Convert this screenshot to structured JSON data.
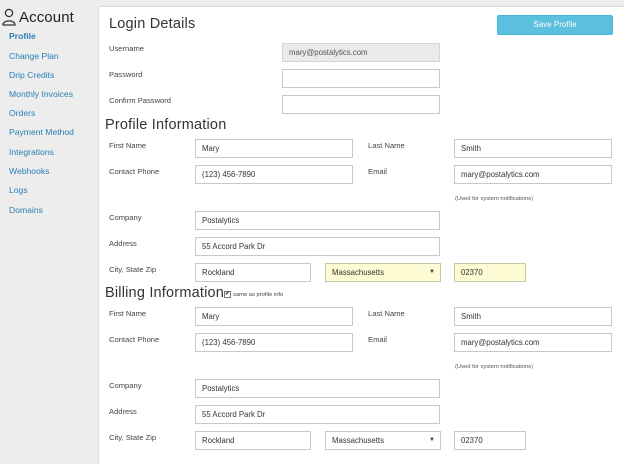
{
  "sidebar": {
    "title": "Account",
    "items": [
      {
        "label": "Profile",
        "active": true
      },
      {
        "label": "Change Plan"
      },
      {
        "label": "Drip Credits"
      },
      {
        "label": "Monthly Invoices"
      },
      {
        "label": "Orders"
      },
      {
        "label": "Payment Method"
      },
      {
        "label": "Integrations"
      },
      {
        "label": "Webhooks"
      },
      {
        "label": "Logs"
      },
      {
        "label": "Domains"
      }
    ]
  },
  "login": {
    "heading": "Login Details",
    "save_label": "Save Profile",
    "username_label": "Username",
    "username_value": "mary@postalytics.com",
    "password_label": "Password",
    "confirm_label": "Confirm Password"
  },
  "profile": {
    "heading": "Profile Information",
    "first_name_label": "First Name",
    "first_name": "Mary",
    "last_name_label": "Last Name",
    "last_name": "Smith",
    "phone_label": "Contact Phone",
    "phone": "(123) 456-7890",
    "email_label": "Email",
    "email": "mary@postalytics.com",
    "email_note": "(Used for system notifications)",
    "company_label": "Company",
    "company": "Postalytics",
    "address_label": "Address",
    "address": "55 Accord Park Dr",
    "csz_label": "City, State Zip",
    "city": "Rockland",
    "state": "Massachusetts",
    "zip": "02370"
  },
  "billing": {
    "heading": "Billing Information",
    "same_label": "same as profile info",
    "same_checked": "✔",
    "first_name_label": "First Name",
    "first_name": "Mary",
    "last_name_label": "Last Name",
    "last_name": "Smith",
    "phone_label": "Contact Phone",
    "phone": "(123) 456-7890",
    "email_label": "Email",
    "email": "mary@postalytics.com",
    "email_note": "(Used for system notifications)",
    "company_label": "Company",
    "company": "Postalytics",
    "address_label": "Address",
    "address": "55 Accord Park Dr",
    "csz_label": "City, State Zip",
    "city": "Rockland",
    "state": "Massachusetts",
    "zip": "02370"
  },
  "icons": {
    "account": "person-icon",
    "dropdown": "chevron-down-icon"
  },
  "colors": {
    "link": "#2a7db3",
    "button": "#5bc0de",
    "autofill": "#fcfbd3"
  }
}
